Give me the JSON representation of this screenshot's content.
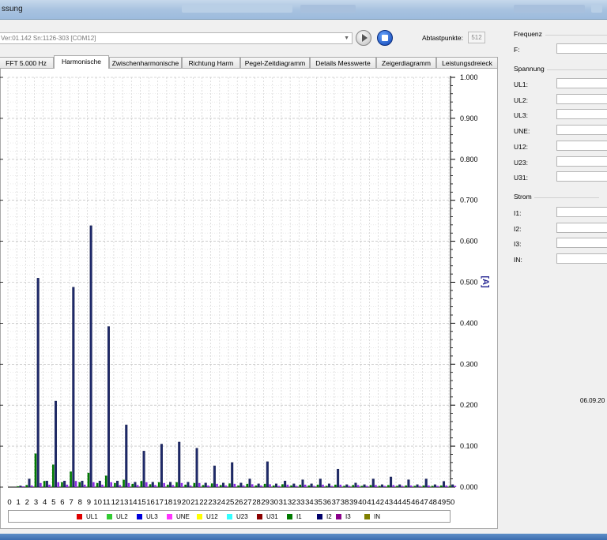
{
  "window": {
    "title": "ssung"
  },
  "toolbar": {
    "device": "Ver:01.142 Sn:1126-303 [COM12]",
    "abtast_label": "Abtastpunkte:",
    "abtast_value": "512"
  },
  "tabs": [
    {
      "label": "FFT 5.000 Hz"
    },
    {
      "label": "Harmonische",
      "active": true
    },
    {
      "label": "Zwischenharmonische"
    },
    {
      "label": "Richtung Harm"
    },
    {
      "label": "Pegel-Zeitdiagramm"
    },
    {
      "label": "Details Messwerte"
    },
    {
      "label": "Zeigerdiagramm"
    },
    {
      "label": "Leistungsdreieck"
    }
  ],
  "chart_data": {
    "type": "bar",
    "ylabel": "[A]",
    "ylim": [
      0,
      1.0
    ],
    "grid": true,
    "y_ticks": [
      "1.000",
      "0.900",
      "0.800",
      "0.700",
      "0.600",
      "0.500",
      "0.400",
      "0.300",
      "0.200",
      "0.100",
      "0.000"
    ],
    "categories": [
      "0",
      "1",
      "2",
      "3",
      "4",
      "5",
      "6",
      "7",
      "8",
      "9",
      "10",
      "11",
      "12",
      "13",
      "14",
      "15",
      "16",
      "17",
      "18",
      "19",
      "20",
      "21",
      "22",
      "23",
      "24",
      "25",
      "26",
      "27",
      "28",
      "29",
      "30",
      "31",
      "32",
      "33",
      "34",
      "35",
      "36",
      "37",
      "38",
      "39",
      "40",
      "41",
      "42",
      "43",
      "44",
      "45",
      "46",
      "47",
      "48",
      "49",
      "50"
    ],
    "series": [
      {
        "name": "I1",
        "color": "#007a00",
        "values": [
          0,
          0.002,
          0.005,
          0.082,
          0.015,
          0.055,
          0.012,
          0.038,
          0.012,
          0.035,
          0.01,
          0.028,
          0.01,
          0.018,
          0.008,
          0.015,
          0.007,
          0.012,
          0.006,
          0.012,
          0.006,
          0.01,
          0.005,
          0.009,
          0.005,
          0.009,
          0.004,
          0.008,
          0.004,
          0.008,
          0.004,
          0.007,
          0.004,
          0.006,
          0.004,
          0.006,
          0.003,
          0.006,
          0.003,
          0.005,
          0.003,
          0.005,
          0.003,
          0.005,
          0.003,
          0.004,
          0.003,
          0.004,
          0.003,
          0.004,
          0.003
        ]
      },
      {
        "name": "I2",
        "color": "#1f2a6b",
        "values": [
          0,
          0.003,
          0.02,
          0.51,
          0.015,
          0.21,
          0.015,
          0.488,
          0.015,
          0.638,
          0.015,
          0.392,
          0.015,
          0.152,
          0.012,
          0.088,
          0.012,
          0.105,
          0.012,
          0.11,
          0.012,
          0.095,
          0.01,
          0.052,
          0.01,
          0.06,
          0.01,
          0.02,
          0.008,
          0.062,
          0.008,
          0.015,
          0.008,
          0.018,
          0.008,
          0.02,
          0.008,
          0.044,
          0.006,
          0.01,
          0.006,
          0.02,
          0.006,
          0.025,
          0.006,
          0.018,
          0.006,
          0.02,
          0.006,
          0.014,
          0.006
        ]
      },
      {
        "name": "I3",
        "color": "#8a2be2",
        "values": [
          0,
          0.002,
          0.004,
          0.01,
          0.006,
          0.012,
          0.006,
          0.015,
          0.006,
          0.012,
          0.006,
          0.012,
          0.005,
          0.01,
          0.005,
          0.012,
          0.005,
          0.01,
          0.005,
          0.01,
          0.004,
          0.01,
          0.004,
          0.008,
          0.004,
          0.008,
          0.004,
          0.007,
          0.004,
          0.007,
          0.003,
          0.006,
          0.003,
          0.006,
          0.003,
          0.006,
          0.003,
          0.006,
          0.003,
          0.005,
          0.003,
          0.005,
          0.003,
          0.005,
          0.003,
          0.004,
          0.003,
          0.004,
          0.003,
          0.004,
          0.003
        ]
      }
    ]
  },
  "legend": [
    {
      "label": "UL1",
      "color": "#e00000"
    },
    {
      "label": "UL2",
      "color": "#33cc33"
    },
    {
      "label": "UL3",
      "color": "#0000dd"
    },
    {
      "label": "UNE",
      "color": "#ff33ff"
    },
    {
      "label": "U12",
      "color": "#ffff00"
    },
    {
      "label": "U23",
      "color": "#33ffff"
    },
    {
      "label": "U31",
      "color": "#8b0000"
    },
    {
      "label": "I1",
      "color": "#007a00"
    },
    {
      "label": "I2",
      "color": "#00006b"
    },
    {
      "label": "I3",
      "color": "#8a008a"
    },
    {
      "label": "IN",
      "color": "#808000"
    }
  ],
  "panel": {
    "frequenz_title": "Frequenz",
    "f_label": "F:",
    "spannung_title": "Spannung",
    "spannung_fields": [
      "UL1:",
      "UL2:",
      "UL3:",
      "UNE:",
      "U12:",
      "U23:",
      "U31:"
    ],
    "strom_title": "Strom",
    "strom_fields": [
      "I1:",
      "I2:",
      "I3:",
      "IN:"
    ],
    "datetime": "06.09.20"
  }
}
